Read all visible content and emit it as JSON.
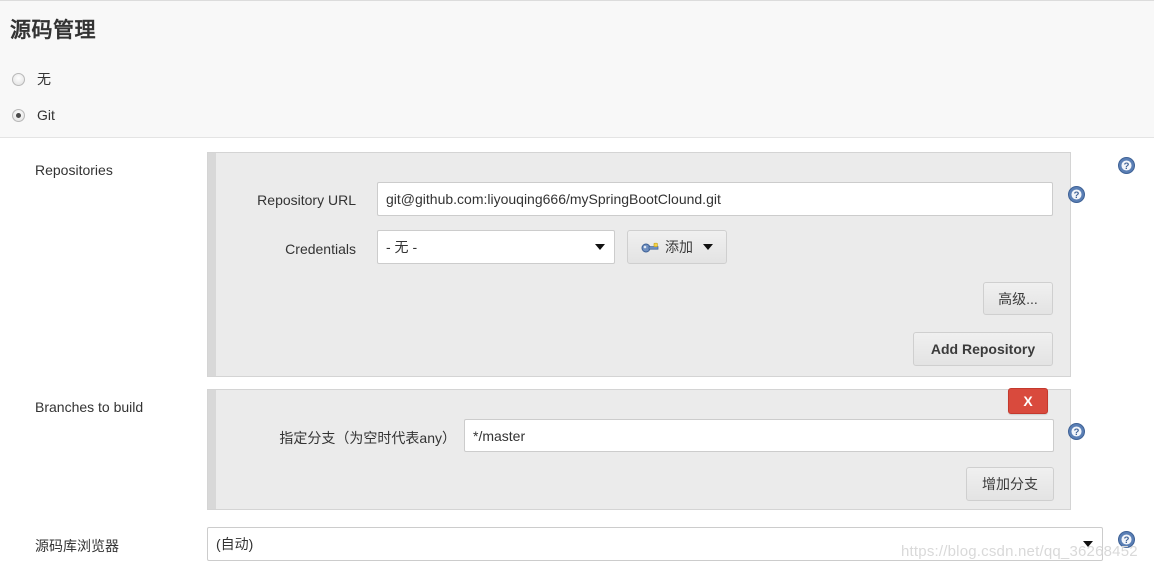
{
  "page": {
    "title": "源码管理"
  },
  "scm_radios": [
    {
      "label": "无",
      "checked": false,
      "name": "radio-option-none"
    },
    {
      "label": "Git",
      "checked": true,
      "name": "radio-option-git"
    }
  ],
  "repositories": {
    "section_label": "Repositories",
    "url_label": "Repository URL",
    "url_value": "git@github.com:liyouqing666/mySpringBootClound.git",
    "credentials_label": "Credentials",
    "credentials_value": "- 无 -",
    "add_credentials_label": "添加",
    "advanced_label": "高级...",
    "add_repository_label": "Add Repository"
  },
  "branches": {
    "section_label": "Branches to build",
    "branch_label": "指定分支（为空时代表any）",
    "branch_value": "*/master",
    "delete_label": "X",
    "add_branch_label": "增加分支"
  },
  "repository_browser": {
    "section_label": "源码库浏览器",
    "value": "(自动)"
  },
  "icons": {
    "help": "help-icon",
    "key": "key-icon",
    "caret": "chevron-down-icon"
  },
  "colors": {
    "accent_help": "#4a72a8",
    "danger": "#d94a3d",
    "panel_bg": "#ebebeb",
    "page_bg": "#ffffff",
    "band_bg": "#f8f8f8"
  },
  "watermark": {
    "text": "https://blog.csdn.net/qq_36268452"
  }
}
